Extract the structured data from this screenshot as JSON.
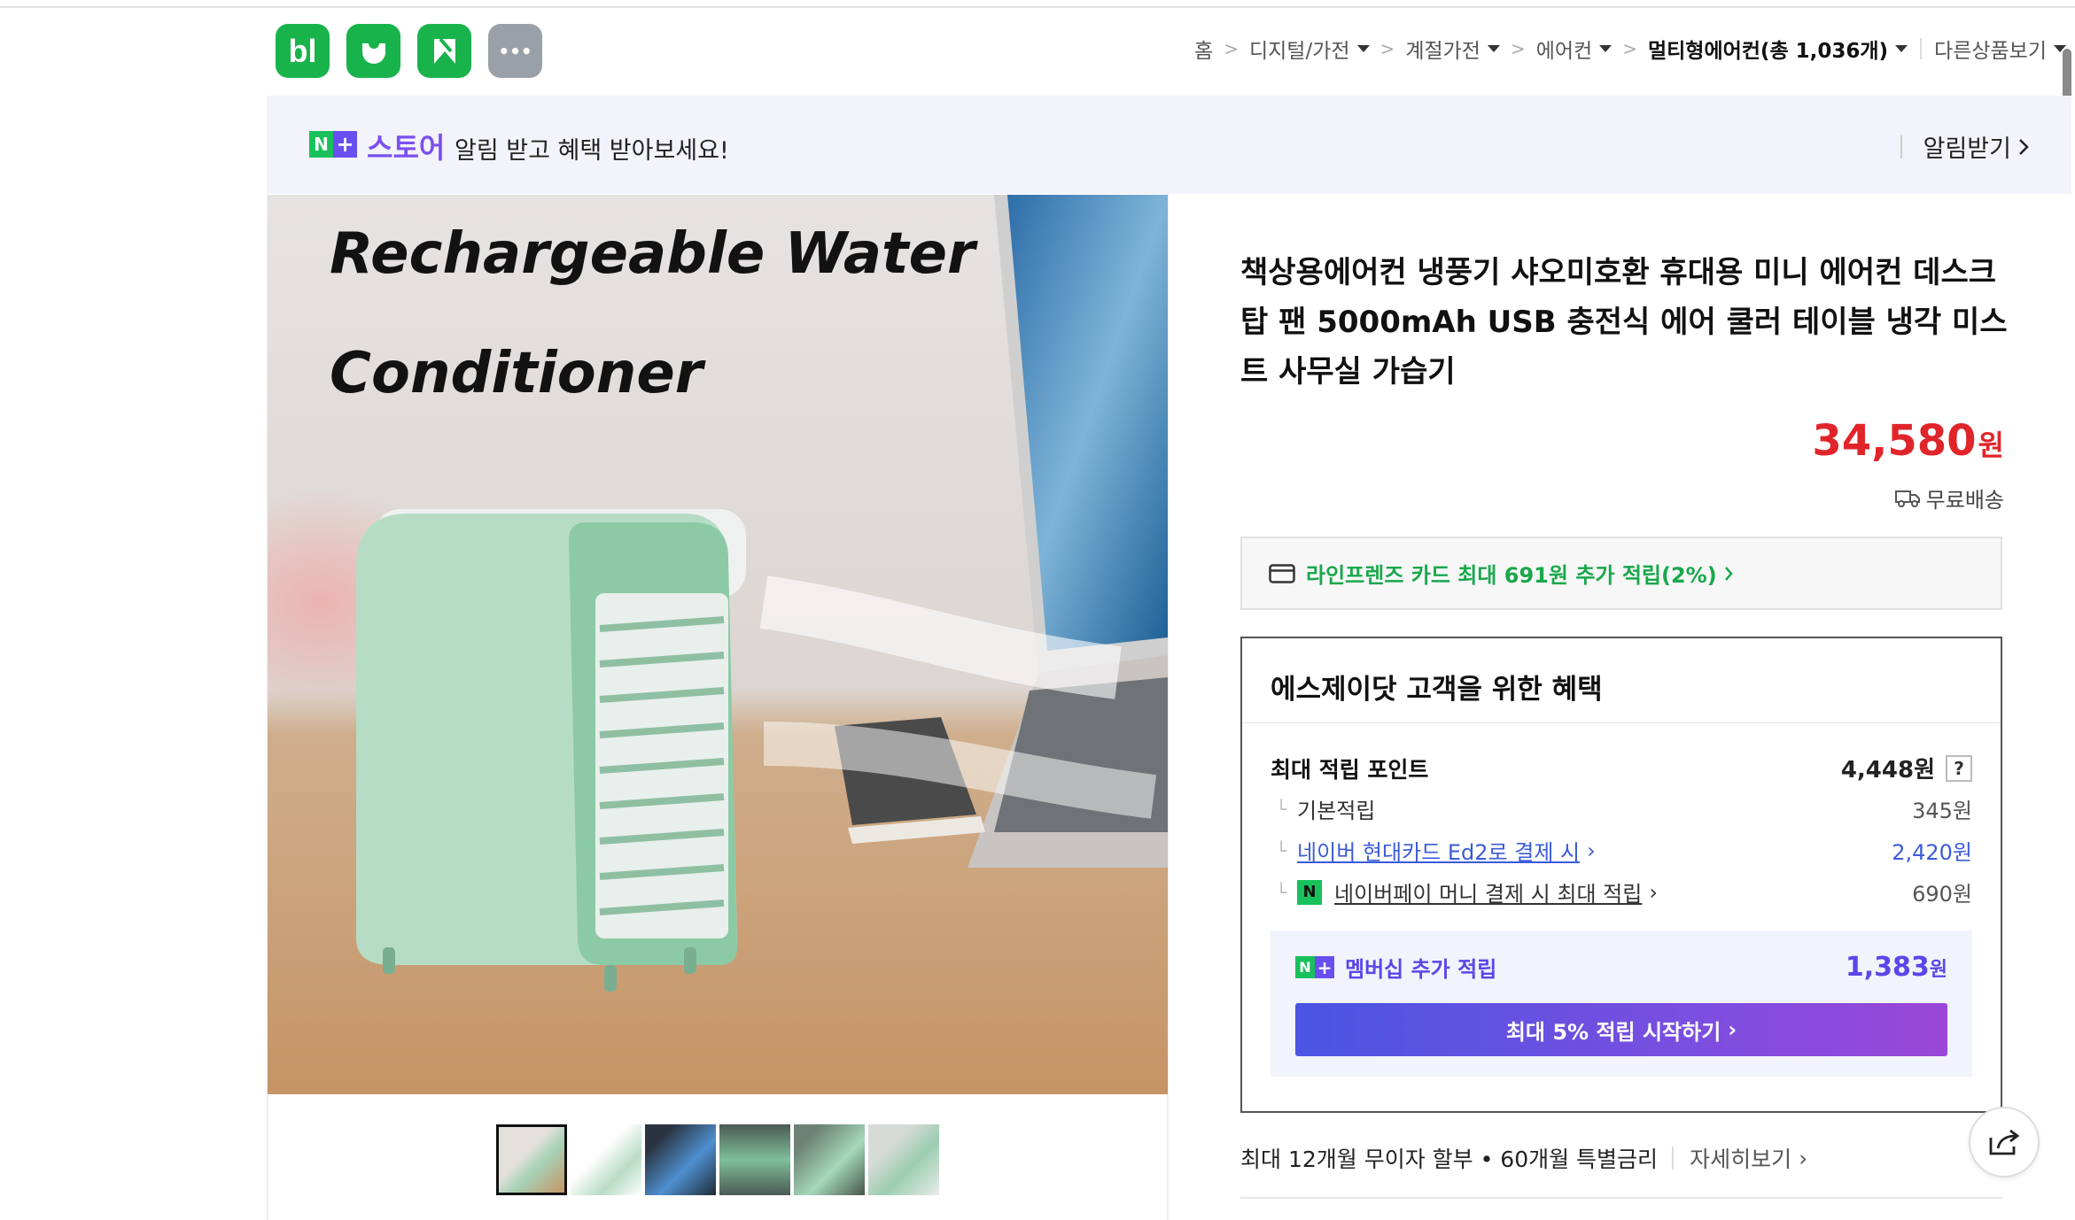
{
  "apps": [
    {
      "name": "blog",
      "label": "bl"
    },
    {
      "name": "cafe",
      "label": ""
    },
    {
      "name": "bookmark",
      "label": ""
    },
    {
      "name": "more",
      "label": "•••"
    }
  ],
  "breadcrumb": {
    "items": [
      "홈",
      "디지털/가전",
      "계절가전",
      "에어컨"
    ],
    "current": "멀티형에어컨(총 1,036개)",
    "other": "다른상품보기"
  },
  "banner": {
    "n_label": "N",
    "plus_label": "+",
    "store": "스토어",
    "text": "알림 받고 혜택 받아보세요!",
    "action": "알림받기"
  },
  "hero": {
    "line1": "Rechargeable Water",
    "line2": "Conditioner"
  },
  "product": {
    "title": "책상용에어컨 냉풍기 샤오미호환 휴대용 미니 에어컨 데스크탑 팬 5000mAh USB 충전식 에어 쿨러 테이블 냉각 미스트 사무실 가습기",
    "price": "34,580",
    "currency": "원",
    "shipping": "무료배송"
  },
  "card_offer": "라인프렌즈 카드 최대 691원 추가 적립(2%)",
  "benefit": {
    "title": "에스제이닷 고객을 위한 혜택",
    "max_points_label": "최대 적립 포인트",
    "max_points_value": "4,448원",
    "help": "?",
    "rows": [
      {
        "label": "기본적립",
        "value": "345원"
      },
      {
        "label": "네이버 현대카드 Ed2로 결제 시",
        "value": "2,420원"
      },
      {
        "label": "네이버페이 머니 결제 시 최대 적립",
        "value": "690원"
      }
    ],
    "npay_badge": "N",
    "membership_label": "멤버십 추가 적립",
    "membership_value": "1,383",
    "membership_unit": "원",
    "cta": "최대 5% 적립 시작하기"
  },
  "installment": {
    "text": "최대 12개월 무이자 할부 • 60개월 특별금리",
    "more": "자세히보기"
  },
  "colors": {
    "price": "#e0252a",
    "naver_green": "#19c15c",
    "membership_purple": "#5b45e8",
    "link_blue": "#3b5bd8"
  }
}
